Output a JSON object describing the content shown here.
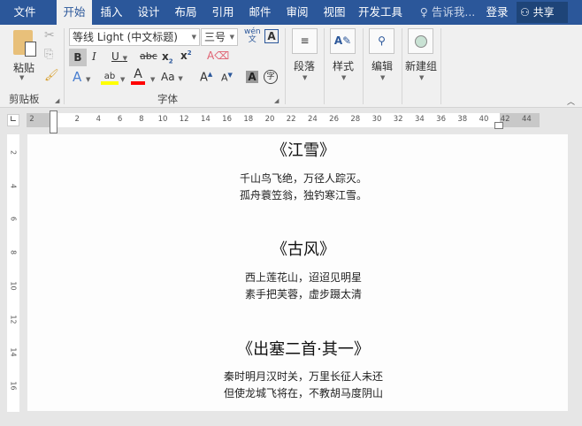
{
  "tabs": [
    {
      "label": "文件"
    },
    {
      "label": "开始"
    },
    {
      "label": "插入"
    },
    {
      "label": "设计"
    },
    {
      "label": "布局"
    },
    {
      "label": "引用"
    },
    {
      "label": "邮件"
    },
    {
      "label": "审阅"
    },
    {
      "label": "视图"
    },
    {
      "label": "开发工具"
    }
  ],
  "active_tab": "开始",
  "tell_me": "告诉我...",
  "login": "登录",
  "share": "共享",
  "clipboard": {
    "paste": "粘贴",
    "group": "剪贴板"
  },
  "font": {
    "name": "等线 Light (中文标题)",
    "size": "三号",
    "group": "字体",
    "highlight_color": "#ffff00",
    "font_color": "#ff0000"
  },
  "groups": {
    "paragraph": "段落",
    "styles": "样式",
    "editing": "编辑",
    "new_group": "新建组"
  },
  "ruler": {
    "h_ticks": [
      "2",
      "2",
      "4",
      "6",
      "8",
      "10",
      "12",
      "14",
      "16",
      "18",
      "20",
      "22",
      "24",
      "26",
      "28",
      "30",
      "32",
      "34",
      "36",
      "38",
      "40",
      "42",
      "44"
    ],
    "v_ticks": [
      "2",
      "4",
      "6",
      "8",
      "10",
      "12",
      "14",
      "16"
    ]
  },
  "document": {
    "poems": [
      {
        "title": "《江雪》",
        "lines": [
          "千山鸟飞绝，万径人踪灭。",
          "孤舟蓑笠翁，独钓寒江雪。"
        ]
      },
      {
        "title": "《古风》",
        "lines": [
          "西上莲花山，迢迢见明星",
          "素手把芙蓉，虚步蹑太清"
        ]
      },
      {
        "title": "《出塞二首·其一》",
        "lines": [
          "秦时明月汉时关，万里长征人未还",
          "但使龙城飞将在，不教胡马度阴山"
        ]
      }
    ]
  }
}
